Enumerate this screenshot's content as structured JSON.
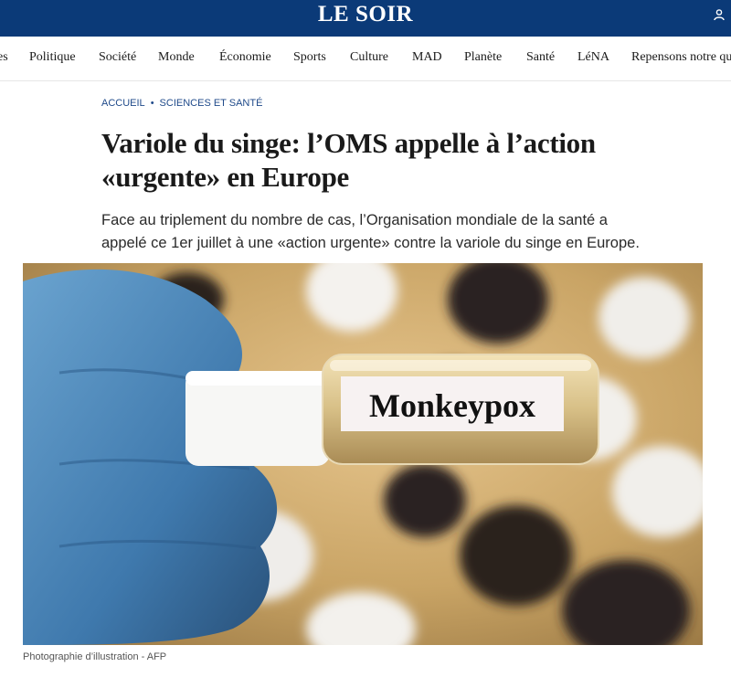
{
  "header": {
    "logo": "LE SOIR",
    "user_icon": "user-icon"
  },
  "nav": {
    "items": [
      {
        "label": "es"
      },
      {
        "label": "Politique"
      },
      {
        "label": "Société"
      },
      {
        "label": "Monde"
      },
      {
        "label": "Économie"
      },
      {
        "label": "Sports"
      },
      {
        "label": "Culture"
      },
      {
        "label": "MAD"
      },
      {
        "label": "Planète"
      },
      {
        "label": "Santé"
      },
      {
        "label": "LéNA"
      },
      {
        "label": "Repensons notre qu"
      }
    ]
  },
  "breadcrumb": {
    "home": "ACCUEIL",
    "section": "SCIENCES ET SANTÉ"
  },
  "article": {
    "title": "Variole du singe: l’OMS appelle à l’action «urgente» en Europe",
    "lead": "Face au triplement du nombre de cas, l’Organisation mondiale de la santé a appelé ce 1er juillet à une «action urgente» contre la variole du singe en Europe.",
    "image_label": "Monkeypox",
    "caption": "Photographie d’illustration - AFP"
  },
  "colors": {
    "brand": "#0b3a78",
    "link": "#1f4a8a"
  }
}
